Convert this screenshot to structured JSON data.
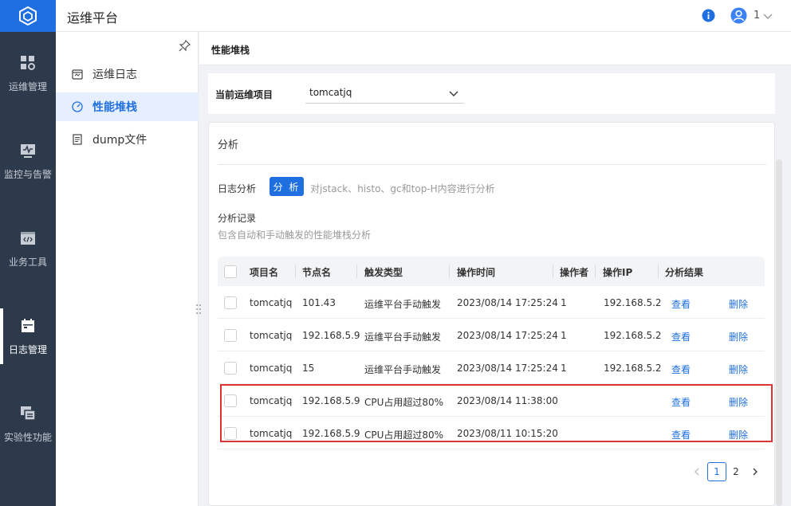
{
  "app": {
    "title": "运维平台"
  },
  "header": {
    "user_name": "1",
    "icons": [
      "info-icon",
      "user-icon",
      "chevron-down-icon"
    ]
  },
  "rail": {
    "items": [
      {
        "label": "运维管理",
        "icon": "dashboard-icon"
      },
      {
        "label": "监控与告警",
        "icon": "monitor-icon"
      },
      {
        "label": "业务工具",
        "icon": "code-window-icon"
      },
      {
        "label": "日志管理",
        "icon": "calendar-icon",
        "active": true
      },
      {
        "label": "实验性功能",
        "icon": "windows-icon"
      }
    ]
  },
  "subnav": {
    "items": [
      {
        "label": "运维日志",
        "icon": "calendar-icon"
      },
      {
        "label": "性能堆栈",
        "icon": "gauge-icon",
        "active": true
      },
      {
        "label": "dump文件",
        "icon": "document-icon"
      }
    ]
  },
  "page": {
    "title": "性能堆栈"
  },
  "project": {
    "label": "当前运维项目",
    "value": "tomcatjq"
  },
  "analysis": {
    "section_title": "分析",
    "log_label": "日志分析",
    "analyze_button": "分 析",
    "analyze_desc": "对jstack、histo、gc和top-H内容进行分析",
    "records_title": "分析记录",
    "records_desc": "包含自动和手动触发的性能堆栈分析"
  },
  "table": {
    "headers": [
      "项目名",
      "节点名",
      "触发类型",
      "操作时间",
      "操作者",
      "操作IP",
      "分析结果"
    ],
    "rows": [
      [
        "tomcatjq",
        "101.43",
        "运维平台手动触发",
        "2023/08/14 17:25:24",
        "1",
        "192.168.5.2",
        "查看",
        "删除"
      ],
      [
        "tomcatjq",
        "192.168.5.9",
        "运维平台手动触发",
        "2023/08/14 17:25:24",
        "1",
        "192.168.5.2",
        "查看",
        "删除"
      ],
      [
        "tomcatjq",
        "15",
        "运维平台手动触发",
        "2023/08/14 17:25:24",
        "1",
        "192.168.5.2",
        "查看",
        "删除"
      ],
      [
        "tomcatjq",
        "192.168.5.9",
        "CPU占用超过80%",
        "2023/08/14 11:38:00",
        "",
        "",
        "查看",
        "删除"
      ],
      [
        "tomcatjq",
        "192.168.5.9",
        "CPU占用超过80%",
        "2023/08/11 10:15:20",
        "",
        "",
        "查看",
        "删除"
      ]
    ],
    "highlighted_rows": [
      3,
      4
    ]
  },
  "pagination": {
    "pages": [
      "1",
      "2"
    ],
    "current": "1"
  },
  "colors": {
    "accent": "#1f6fe0",
    "rail_bg": "#2d3a4b",
    "highlight": "#e03232"
  }
}
